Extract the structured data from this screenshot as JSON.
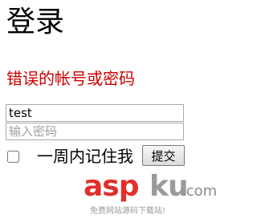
{
  "page": {
    "title": "登录",
    "error_message": "错误的帐号或密码"
  },
  "form": {
    "username_value": "test",
    "password_placeholder": "输入密码",
    "remember_label": "一周内记住我",
    "remember_checked": false,
    "submit_label": "提交"
  },
  "watermark": {
    "brand_asp": "asp",
    "brand_ku": "ku",
    "brand_com": ".com",
    "tagline": "免费网站源码下载站!",
    "colors": {
      "asp": "#e0302c",
      "ku": "#9a9a9a"
    }
  },
  "colors": {
    "error": "#cc0000"
  }
}
